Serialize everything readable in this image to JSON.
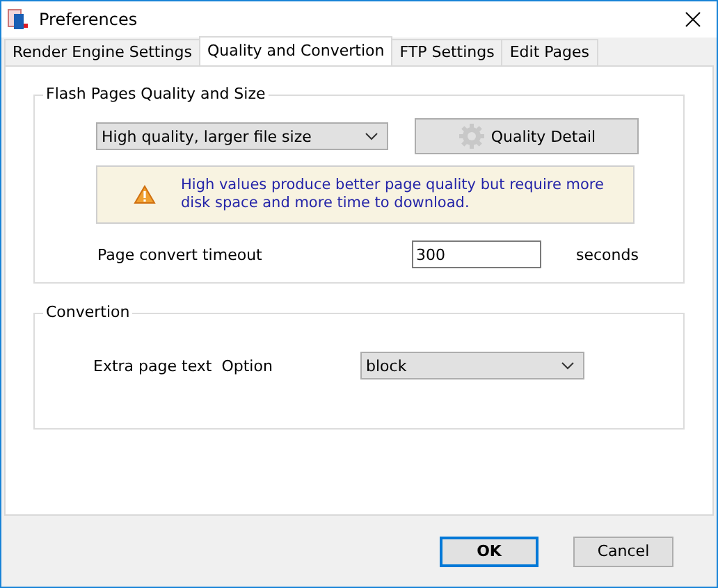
{
  "window": {
    "title": "Preferences"
  },
  "tabs": [
    {
      "label": "Render Engine Settings",
      "selected": false
    },
    {
      "label": "Quality and Convertion",
      "selected": true
    },
    {
      "label": "FTP Settings",
      "selected": false
    },
    {
      "label": "Edit Pages",
      "selected": false
    }
  ],
  "quality_group": {
    "title": "Flash Pages Quality and Size",
    "quality_dropdown": {
      "value": "High quality, larger file size"
    },
    "detail_button": "Quality Detail",
    "notice": "High values produce better page quality but require more disk space and more time to download.",
    "timeout_label": "Page convert timeout",
    "timeout_value": "300",
    "timeout_unit": "seconds"
  },
  "convertion_group": {
    "title": "Convertion",
    "option_label": "Extra page text  Option",
    "option_dropdown": {
      "value": "block"
    }
  },
  "buttons": [
    {
      "label": "OK",
      "default": true
    },
    {
      "label": "Cancel",
      "default": false
    }
  ]
}
